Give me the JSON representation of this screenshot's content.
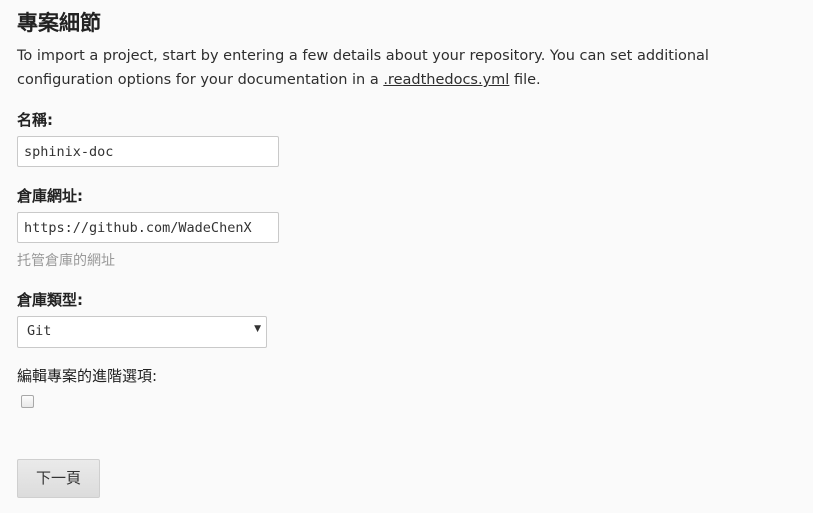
{
  "header": {
    "title": "專案細節"
  },
  "intro": {
    "text_before": "To import a project, start by entering a few details about your repository. You can set additional configuration options for your documentation in a ",
    "link": ".readthedocs.yml",
    "text_after": " file."
  },
  "form": {
    "name": {
      "label": "名稱:",
      "value": "sphinix-doc"
    },
    "repo_url": {
      "label": "倉庫網址:",
      "value": "https://github.com/WadeChenX",
      "help": "托管倉庫的網址"
    },
    "repo_type": {
      "label": "倉庫類型:",
      "selected": "Git"
    },
    "advanced": {
      "label": "編輯專案的進階選項:",
      "checked": false
    },
    "next_button": "下一頁"
  }
}
